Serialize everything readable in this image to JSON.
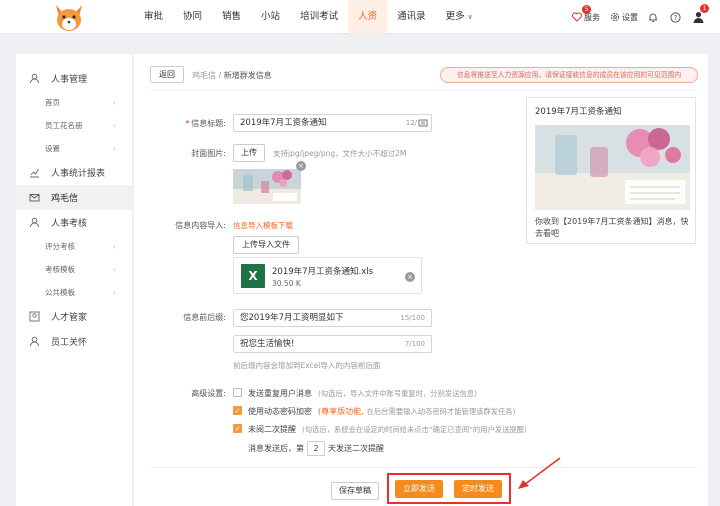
{
  "nav": {
    "items": [
      {
        "label": "审批"
      },
      {
        "label": "协同"
      },
      {
        "label": "销售"
      },
      {
        "label": "小站"
      },
      {
        "label": "培训考试"
      },
      {
        "label": "人资"
      },
      {
        "label": "通讯录"
      },
      {
        "label": "更多"
      }
    ],
    "active_index": 5,
    "service_label": "服务",
    "service_badge": "5",
    "settings_label": "设置",
    "user_badge": "1"
  },
  "sidebar": {
    "items": [
      {
        "label": "人事管理",
        "type": "group",
        "icon": "person-icon"
      },
      {
        "label": "首页",
        "type": "sub"
      },
      {
        "label": "员工花名册",
        "type": "sub"
      },
      {
        "label": "设置",
        "type": "sub"
      },
      {
        "label": "人事统计报表",
        "type": "group",
        "icon": "chart-icon"
      },
      {
        "label": "鸡毛信",
        "type": "group",
        "icon": "mail-icon",
        "active": true
      },
      {
        "label": "人事考核",
        "type": "group",
        "icon": "person-icon"
      },
      {
        "label": "评分考核",
        "type": "sub"
      },
      {
        "label": "考核模板",
        "type": "sub"
      },
      {
        "label": "公共模板",
        "type": "sub"
      },
      {
        "label": "人才管家",
        "type": "group",
        "icon": "talent-icon"
      },
      {
        "label": "员工关怀",
        "type": "group",
        "icon": "person-icon"
      }
    ]
  },
  "header": {
    "back_label": "返回",
    "crumb_parent": "鸡毛信",
    "crumb_sep": " / ",
    "crumb_current": "新增群发信息",
    "notice": "信息将推送至人力资源应用，请保证接收信息的成员在该应用的可见范围内"
  },
  "form": {
    "title_label": "信息标题:",
    "title_value": "2019年7月工资条通知",
    "title_count": "12/",
    "cover_label": "封面图片:",
    "upload_label": "上传",
    "cover_hint": "支持jpg/jpeg/png，文件大小不超过2M",
    "import_label": "信息内容导入:",
    "template_link": "信息导入模板下载",
    "upload_file_label": "上传导入文件",
    "file_name": "2019年7月工资条通知.xls",
    "file_size": "30.50 K",
    "file_icon_text": "X",
    "prefix_label": "信息前后缀:",
    "prefix_value": "您2019年7月工资明显如下",
    "prefix_count": "15/100",
    "suffix_value": "祝您生活愉快!",
    "suffix_count": "7/100",
    "prefix_hint": "前后缀内容会增加到Excel导入的内容前后面",
    "advanced_label": "高级设置:",
    "opt1_label": "发送重复用户消息",
    "opt1_hint": "(勾选后，导入文件中账号重复时，分别发送信息)",
    "opt2_label": "使用动态密码加密",
    "opt2_feature": "(尊享版功能,",
    "opt2_hint": "在后台需要输入动态密码才能管理该群发任务)",
    "opt3_label": "未阅二次提醒",
    "opt3_hint": "(勾选后，系统会在设定的时间给未点击“确定已查阅”的用户发送提醒)",
    "remind_prefix": "消息发送后，第",
    "remind_days": "2",
    "remind_suffix": "天发送二次提醒",
    "checked": [
      false,
      true,
      true
    ]
  },
  "actions": {
    "draft_label": "保存草稿",
    "send_now_label": "立即发送",
    "schedule_label": "定时发送"
  },
  "preview": {
    "title": "2019年7月工资条通知",
    "text": "你收到【2019年7月工资条通知】消息，快去看吧"
  },
  "colors": {
    "accent": "#f58a1f",
    "highlight_box": "#e5322d"
  }
}
